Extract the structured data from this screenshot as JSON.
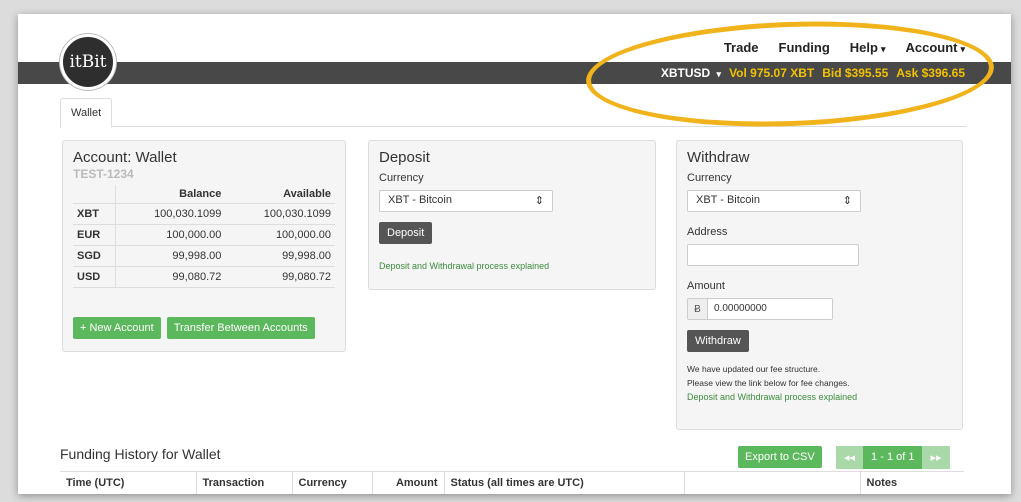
{
  "logo": {
    "text": "itBit"
  },
  "nav": {
    "items": [
      {
        "label": "Trade",
        "caret": false
      },
      {
        "label": "Funding",
        "caret": false
      },
      {
        "label": "Help",
        "caret": true
      },
      {
        "label": "Account",
        "caret": true
      }
    ]
  },
  "ticker": {
    "pair": "XBTUSD",
    "vol": "Vol 975.07 XBT",
    "bid": "Bid $395.55",
    "ask": "Ask $396.65",
    "color_highlight": "#f2c200"
  },
  "tabs": {
    "wallet": "Wallet"
  },
  "account": {
    "title": "Account:  Wallet",
    "id": "TEST-1234",
    "headers": {
      "balance": "Balance",
      "available": "Available"
    },
    "rows": [
      {
        "currency": "XBT",
        "balance": "100,030.1099",
        "available": "100,030.1099"
      },
      {
        "currency": "EUR",
        "balance": "100,000.00",
        "available": "100,000.00"
      },
      {
        "currency": "SGD",
        "balance": "99,998.00",
        "available": "99,998.00"
      },
      {
        "currency": "USD",
        "balance": "99,080.72",
        "available": "99,080.72"
      }
    ],
    "new_account": "+ New Account",
    "transfer": "Transfer Between Accounts"
  },
  "deposit": {
    "title": "Deposit",
    "currency_label": "Currency",
    "currency_value": "XBT - Bitcoin",
    "button": "Deposit",
    "link": "Deposit and Withdrawal process explained"
  },
  "withdraw": {
    "title": "Withdraw",
    "currency_label": "Currency",
    "currency_value": "XBT - Bitcoin",
    "address_label": "Address",
    "amount_label": "Amount",
    "amount_symbol": "Ƀ",
    "amount_value": "0.00000000",
    "button": "Withdraw",
    "note1": "We have updated our fee structure.",
    "note2": "Please view the link below for fee changes.",
    "link": "Deposit and Withdrawal process explained"
  },
  "history": {
    "title": "Funding History for Wallet",
    "export": "Export to CSV",
    "pager_prev": "◂◂",
    "pager_info": "1 - 1 of 1",
    "pager_next": "▸▸",
    "columns": [
      "Time (UTC)",
      "Transaction",
      "Currency",
      "Amount",
      "Status (all times are UTC)",
      "",
      "Notes"
    ]
  },
  "colors": {
    "accent_green": "#5cb85c",
    "nav_dark": "#484848",
    "annotation_ring": "#f0b31c"
  }
}
